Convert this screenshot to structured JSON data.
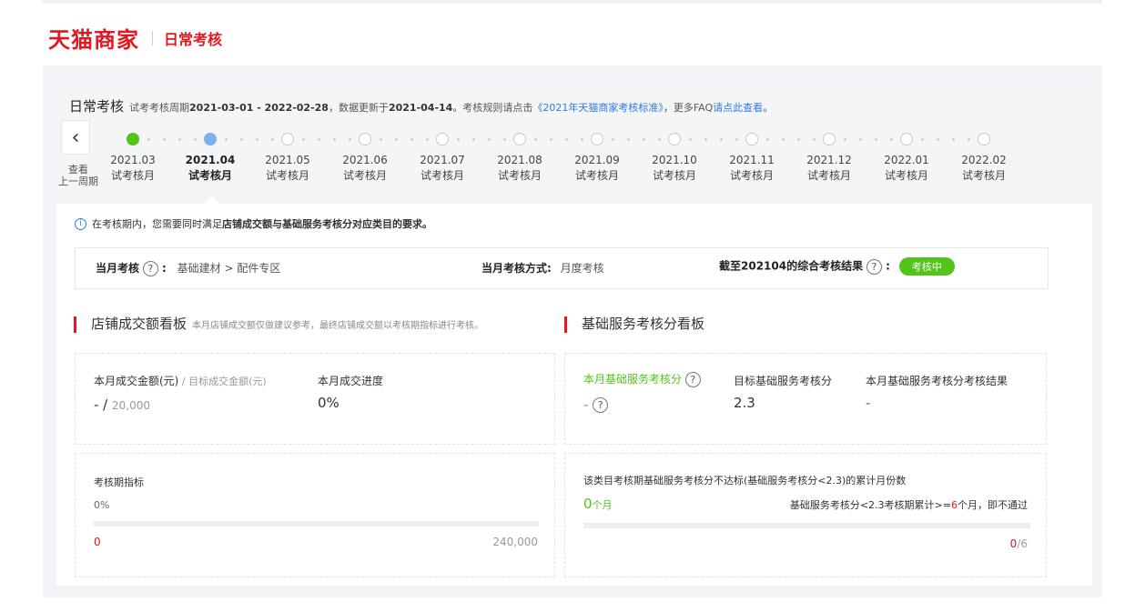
{
  "header": {
    "brand": "天猫商家",
    "subtitle": "日常考核"
  },
  "title_row": {
    "title": "日常考核",
    "period_prefix": "试考考核周期",
    "period": "2021-03-01 - 2022-02-28",
    "update_prefix": "，数据更新于",
    "update_date": "2021-04-14",
    "rules_prefix": "。考核规则请点击",
    "rules_link": "《2021年天猫商家考核标准》",
    "faq_prefix": "，更多FAQ",
    "faq_link": "请点此查看",
    "faq_suffix": "。"
  },
  "timeline": {
    "back_icon": "chevron-left-icon",
    "back_label_1": "查看",
    "back_label_2": "上一周期",
    "months": [
      {
        "month": "2021.03",
        "label": "试考核月",
        "state": "done"
      },
      {
        "month": "2021.04",
        "label": "试考核月",
        "state": "current"
      },
      {
        "month": "2021.05",
        "label": "试考核月",
        "state": "future"
      },
      {
        "month": "2021.06",
        "label": "试考核月",
        "state": "future"
      },
      {
        "month": "2021.07",
        "label": "试考核月",
        "state": "future"
      },
      {
        "month": "2021.08",
        "label": "试考核月",
        "state": "future"
      },
      {
        "month": "2021.09",
        "label": "试考核月",
        "state": "future"
      },
      {
        "month": "2021.10",
        "label": "试考核月",
        "state": "future"
      },
      {
        "month": "2021.11",
        "label": "试考核月",
        "state": "future"
      },
      {
        "month": "2021.12",
        "label": "试考核月",
        "state": "future"
      },
      {
        "month": "2022.01",
        "label": "试考核月",
        "state": "future"
      },
      {
        "month": "2022.02",
        "label": "试考核月",
        "state": "future"
      }
    ]
  },
  "tip": {
    "text": "在考核期内，您需要同时满足",
    "bold": "店铺成交额与基础服务考核分对应类目的要求。"
  },
  "info": {
    "assess_label": "当月考核",
    "help_glyph": "?",
    "assess_value": "基础建材 > 配件专区",
    "mode_label": "当月考核方式:",
    "mode_value": "月度考核",
    "result_label": "截至202104的综合考核结果",
    "result_badge": "考核中"
  },
  "left": {
    "title": "店铺成交额看板",
    "note": "本月店铺成交额仅做建议参考，最终店铺成交额以考核期指标进行考核。",
    "amount_label": "本月成交金额(元)",
    "target_label": " / 目标成交金额(元)",
    "amount_value": "- / ",
    "target_value": "20,000",
    "progress_label": "本月成交进度",
    "progress_value": "0%",
    "period_label": "考核期指标",
    "period_pct": "0%",
    "period_progress": 0,
    "min": "0",
    "max": "240,000"
  },
  "right": {
    "title": "基础服务考核分看板",
    "score_label": "本月基础服务考核分",
    "score_value": "-",
    "target_label": "目标基础服务考核分",
    "target_value": "2.3",
    "result_label": "本月基础服务考核分考核结果",
    "result_value": "-",
    "months_label": "该类目考核期基础服务考核分不达标(基础服务考核分<2.3)的累计月份数",
    "months_value": "0",
    "months_unit": "个月",
    "rule_prefix": "基础服务考核分<2.3考核期累计>=",
    "rule_num": "6",
    "rule_suffix": "个月，即不通过",
    "count": "0",
    "count_total": "/6",
    "months_progress": 0
  }
}
